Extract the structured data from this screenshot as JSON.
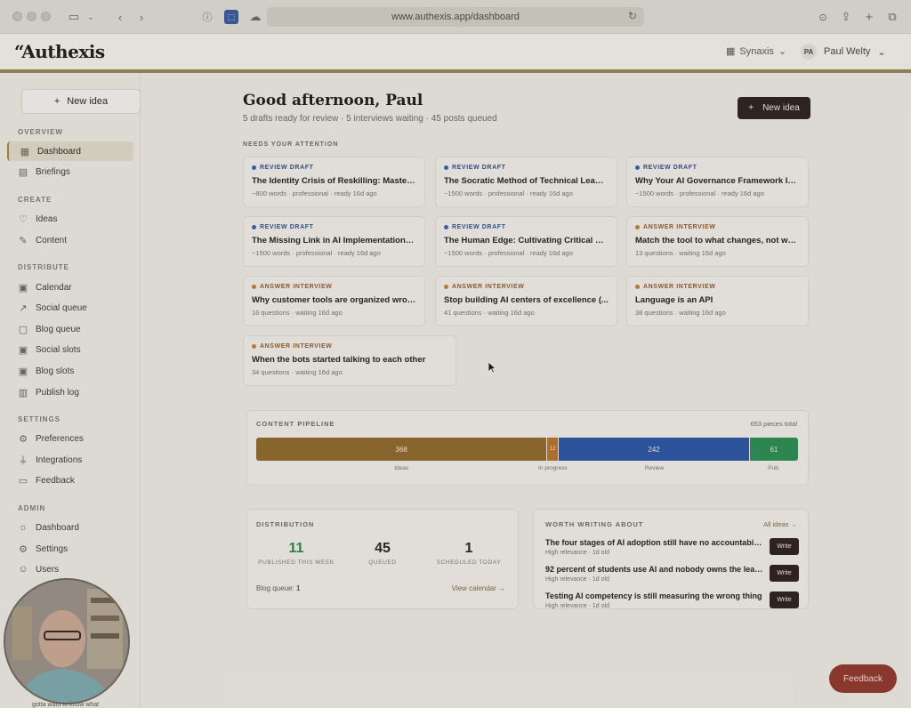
{
  "browser": {
    "url": "www.authexis.app/dashboard",
    "tab_badge": "1"
  },
  "header": {
    "logo": "“Authexis",
    "workspace": "Synaxis",
    "user_initials": "PA",
    "user_name": "Paul Welty"
  },
  "sidebar": {
    "new_idea": "New idea",
    "sections": {
      "overview": "OVERVIEW",
      "create": "CREATE",
      "distribute": "DISTRIBUTE",
      "settings": "SETTINGS",
      "admin": "ADMIN"
    },
    "items": {
      "dashboard": "Dashboard",
      "briefings": "Briefings",
      "ideas": "Ideas",
      "content": "Content",
      "calendar": "Calendar",
      "social_queue": "Social queue",
      "blog_queue": "Blog queue",
      "social_slots": "Social slots",
      "blog_slots": "Blog slots",
      "publish_log": "Publish log",
      "preferences": "Preferences",
      "integrations": "Integrations",
      "feedback": "Feedback",
      "admin_dashboard": "Dashboard",
      "admin_settings": "Settings",
      "users": "Users"
    }
  },
  "main": {
    "greeting": "Good afternoon, Paul",
    "subtitle": "5 drafts ready for review · 5 interviews waiting · 45 posts queued",
    "new_idea": "New idea",
    "attention_label": "NEEDS YOUR ATTENTION",
    "cards": [
      {
        "tag": "REVIEW DRAFT",
        "title": "The Identity Crisis of Reskilling: Mastering...",
        "meta": "~800 words · professional · ready 16d ago"
      },
      {
        "tag": "REVIEW DRAFT",
        "title": "The Socratic Method of Technical Leadership...",
        "meta": "~1500 words · professional · ready 16d ago"
      },
      {
        "tag": "REVIEW DRAFT",
        "title": "Why Your AI Governance Framework Is ...",
        "meta": "~1500 words · professional · ready 16d ago"
      },
      {
        "tag": "REVIEW DRAFT",
        "title": "The Missing Link in AI Implementation: ...",
        "meta": "~1500 words · professional · ready 16d ago"
      },
      {
        "tag": "REVIEW DRAFT",
        "title": "The Human Edge: Cultivating Critical Th...",
        "meta": "~1500 words · professional · ready 16d ago"
      },
      {
        "tag": "ANSWER INTERVIEW",
        "title": "Match the tool to what changes, not wh...",
        "meta": "13 questions · waiting 16d ago"
      },
      {
        "tag": "ANSWER INTERVIEW",
        "title": "Why customer tools are organized wrong",
        "meta": "16 questions · waiting 16d ago"
      },
      {
        "tag": "ANSWER INTERVIEW",
        "title": "Stop building AI centers of excellence (...",
        "meta": "41 questions · waiting 16d ago"
      },
      {
        "tag": "ANSWER INTERVIEW",
        "title": "Language is an API",
        "meta": "38 questions · waiting 16d ago"
      },
      {
        "tag": "ANSWER INTERVIEW",
        "title": "When the bots started talking to each other",
        "meta": "34 questions · waiting 16d ago"
      }
    ],
    "pipeline": {
      "title": "CONTENT PIPELINE",
      "total": "653 pieces total",
      "segments": [
        {
          "label": "Ideas",
          "value": 368,
          "display": "368"
        },
        {
          "label": "In progress",
          "value": 12,
          "display": "12"
        },
        {
          "label": "Review",
          "value": 242,
          "display": "242"
        },
        {
          "label": "Pub.",
          "value": 61,
          "display": "61"
        }
      ]
    },
    "distribution": {
      "title": "DISTRIBUTION",
      "stats": [
        {
          "num": "11",
          "label": "PUBLISHED THIS WEEK"
        },
        {
          "num": "45",
          "label": "QUEUED"
        },
        {
          "num": "1",
          "label": "SCHEDULED TODAY"
        }
      ],
      "blog_queue_label": "Blog queue:",
      "blog_queue_value": "1",
      "view_calendar": "View calendar →"
    },
    "worth_writing": {
      "title": "WORTH WRITING ABOUT",
      "all_ideas": "All ideas →",
      "write_label": "Write",
      "items": [
        {
          "title": "The four stages of AI adoption still have no accountability...",
          "meta": "High relevance · 1d old"
        },
        {
          "title": "92 percent of students use AI and nobody owns the lear...",
          "meta": "High relevance · 1d old"
        },
        {
          "title": "Testing AI competency is still measuring the wrong thing",
          "meta": "High relevance · 1d old"
        }
      ]
    }
  },
  "feedback_button": "Feedback",
  "video_caption": "gotta want to know what",
  "colors": {
    "accent": "#a88440",
    "ideas": "#8f6a2e",
    "review": "#2c56a3",
    "published": "#2e8c52",
    "dark_button": "#2f2420"
  }
}
